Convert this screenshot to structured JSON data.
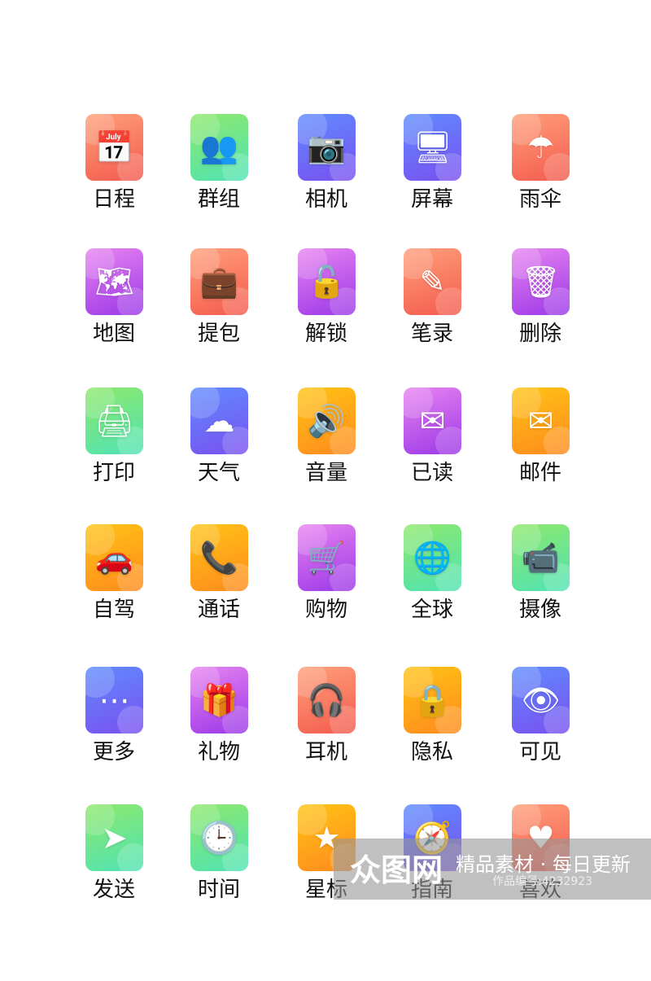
{
  "icons": [
    {
      "label": "日程",
      "icon": "calendar-icon",
      "glyph": "📅",
      "color": "red"
    },
    {
      "label": "群组",
      "icon": "group-icon",
      "glyph": "👥",
      "color": "green"
    },
    {
      "label": "相机",
      "icon": "camera-icon",
      "glyph": "📷",
      "color": "blue"
    },
    {
      "label": "屏幕",
      "icon": "monitor-icon",
      "glyph": "🖥",
      "color": "blue"
    },
    {
      "label": "雨伞",
      "icon": "umbrella-icon",
      "glyph": "☂",
      "color": "red"
    },
    {
      "label": "地图",
      "icon": "map-icon",
      "glyph": "🗺",
      "color": "purple"
    },
    {
      "label": "提包",
      "icon": "bag-icon",
      "glyph": "💼",
      "color": "red"
    },
    {
      "label": "解锁",
      "icon": "unlock-icon",
      "glyph": "🔓",
      "color": "purple"
    },
    {
      "label": "笔录",
      "icon": "pen-icon",
      "glyph": "✎",
      "color": "red"
    },
    {
      "label": "删除",
      "icon": "trash-icon",
      "glyph": "🗑",
      "color": "purple"
    },
    {
      "label": "打印",
      "icon": "printer-icon",
      "glyph": "🖨",
      "color": "green"
    },
    {
      "label": "天气",
      "icon": "cloud-icon",
      "glyph": "☁",
      "color": "blue"
    },
    {
      "label": "音量",
      "icon": "volume-icon",
      "glyph": "🔊",
      "color": "orange"
    },
    {
      "label": "已读",
      "icon": "open-mail-icon",
      "glyph": "✉",
      "color": "purple"
    },
    {
      "label": "邮件",
      "icon": "mail-icon",
      "glyph": "✉",
      "color": "orange"
    },
    {
      "label": "自驾",
      "icon": "car-icon",
      "glyph": "🚗",
      "color": "orange"
    },
    {
      "label": "通话",
      "icon": "phone-icon",
      "glyph": "📞",
      "color": "orange"
    },
    {
      "label": "购物",
      "icon": "cart-icon",
      "glyph": "🛒",
      "color": "purple"
    },
    {
      "label": "全球",
      "icon": "globe-icon",
      "glyph": "🌐",
      "color": "green"
    },
    {
      "label": "摄像",
      "icon": "video-camera-icon",
      "glyph": "📹",
      "color": "green"
    },
    {
      "label": "更多",
      "icon": "more-icon",
      "glyph": "⋯",
      "color": "blue"
    },
    {
      "label": "礼物",
      "icon": "gift-icon",
      "glyph": "🎁",
      "color": "purple"
    },
    {
      "label": "耳机",
      "icon": "headphones-icon",
      "glyph": "🎧",
      "color": "red"
    },
    {
      "label": "隐私",
      "icon": "lock-icon",
      "glyph": "🔒",
      "color": "orange"
    },
    {
      "label": "可见",
      "icon": "eye-icon",
      "glyph": "👁",
      "color": "blue"
    },
    {
      "label": "发送",
      "icon": "send-icon",
      "glyph": "➤",
      "color": "green"
    },
    {
      "label": "时间",
      "icon": "clock-icon",
      "glyph": "🕒",
      "color": "green"
    },
    {
      "label": "星标",
      "icon": "star-icon",
      "glyph": "★",
      "color": "orange"
    },
    {
      "label": "指南",
      "icon": "compass-icon",
      "glyph": "🧭",
      "color": "blue"
    },
    {
      "label": "喜欢",
      "icon": "heart-icon",
      "glyph": "♥",
      "color": "red"
    }
  ],
  "watermark": {
    "logo": "众图网",
    "slogan": "精品素材 · 每日更新",
    "id_text": "作品编号:4232923"
  }
}
